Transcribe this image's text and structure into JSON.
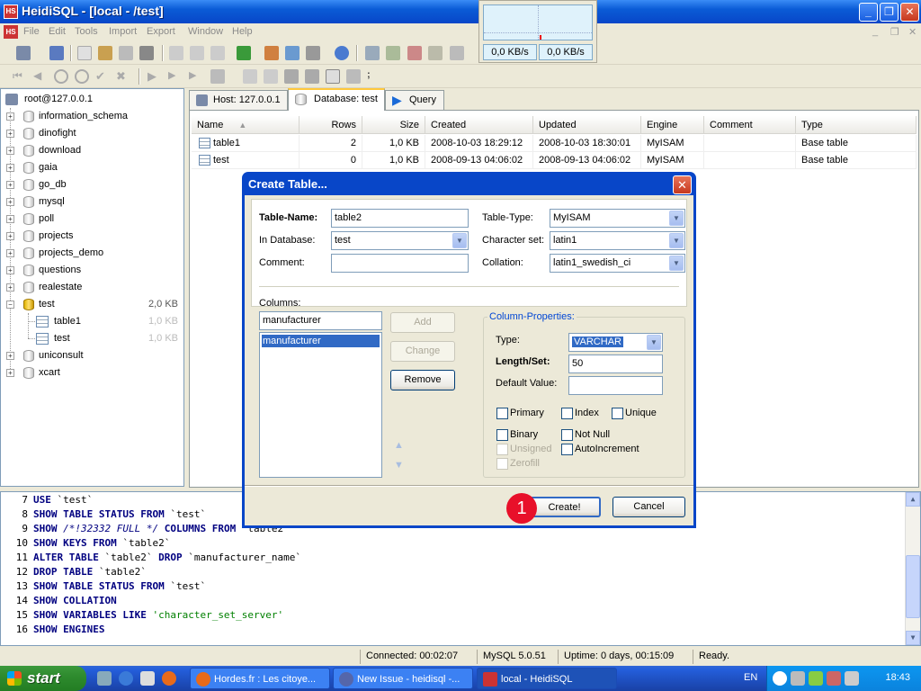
{
  "window": {
    "title": "HeidiSQL - [local - /test]",
    "app_icon": "HS"
  },
  "menu": [
    "File",
    "Edit",
    "Tools",
    "Import",
    "Export",
    "Window",
    "Help"
  ],
  "netmon": {
    "rate_in": "0,0 KB/s",
    "rate_out": "0,0 KB/s"
  },
  "tree": {
    "root": "root@127.0.0.1",
    "databases": [
      {
        "name": "information_schema"
      },
      {
        "name": "dinofight"
      },
      {
        "name": "download"
      },
      {
        "name": "gaia"
      },
      {
        "name": "go_db"
      },
      {
        "name": "mysql"
      },
      {
        "name": "poll"
      },
      {
        "name": "projects"
      },
      {
        "name": "projects_demo"
      },
      {
        "name": "questions"
      },
      {
        "name": "realestate"
      },
      {
        "name": "test",
        "size": "2,0 KB"
      },
      {
        "name": "table1",
        "size": "1,0 KB"
      },
      {
        "name": "test",
        "size": "1,0 KB"
      },
      {
        "name": "uniconsult"
      },
      {
        "name": "xcart"
      }
    ]
  },
  "tabs": [
    "Host: 127.0.0.1",
    "Database: test",
    "Query"
  ],
  "grid": {
    "headers": [
      "Name",
      "Rows",
      "Size",
      "Created",
      "Updated",
      "Engine",
      "Comment",
      "Type"
    ],
    "rows": [
      [
        "table1",
        "2",
        "1,0 KB",
        "2008-10-03 18:29:12",
        "2008-10-03 18:30:01",
        "MyISAM",
        "",
        "Base table"
      ],
      [
        "test",
        "0",
        "1,0 KB",
        "2008-09-13 04:06:02",
        "2008-09-13 04:06:02",
        "MyISAM",
        "",
        "Base table"
      ]
    ]
  },
  "dialog": {
    "title": "Create Table...",
    "table_name_label": "Table-Name:",
    "table_name": "table2",
    "in_database_label": "In Database:",
    "in_database": "test",
    "comment_label": "Comment:",
    "comment": "",
    "table_type_label": "Table-Type:",
    "table_type": "MyISAM",
    "charset_label": "Character set:",
    "charset": "latin1",
    "collation_label": "Collation:",
    "collation": "latin1_swedish_ci",
    "columns_label": "Columns:",
    "column_input": "manufacturer",
    "columns": [
      "manufacturer"
    ],
    "add_label": "Add",
    "change_label": "Change",
    "remove_label": "Remove",
    "props_legend": "Column-Properties:",
    "type_label": "Type:",
    "type_value": "VARCHAR",
    "length_label": "Length/Set:",
    "length_value": "50",
    "default_label": "Default Value:",
    "default_value": "",
    "chk_primary": "Primary",
    "chk_index": "Index",
    "chk_unique": "Unique",
    "chk_binary": "Binary",
    "chk_notnull": "Not Null",
    "chk_unsigned": "Unsigned",
    "chk_autoinc": "AutoIncrement",
    "chk_zerofill": "Zerofill",
    "create_label": "Create!",
    "cancel_label": "Cancel"
  },
  "badge": "1",
  "sql_log": [
    {
      "n": "7",
      "parts": [
        [
          "kw",
          "USE"
        ],
        [
          "",
          " `test`"
        ]
      ]
    },
    {
      "n": "8",
      "parts": [
        [
          "kw",
          "SHOW TABLE STATUS FROM"
        ],
        [
          "",
          " `test`"
        ]
      ]
    },
    {
      "n": "9",
      "parts": [
        [
          "kw",
          "SHOW"
        ],
        [
          "cmt",
          " /*!32332 FULL */"
        ],
        [
          "kw",
          " COLUMNS FROM"
        ],
        [
          "",
          " `table2`"
        ]
      ]
    },
    {
      "n": "10",
      "parts": [
        [
          "kw",
          "SHOW KEYS FROM"
        ],
        [
          "",
          " `table2`"
        ]
      ]
    },
    {
      "n": "11",
      "parts": [
        [
          "kw",
          "ALTER TABLE"
        ],
        [
          "",
          " `table2` "
        ],
        [
          "kw",
          "DROP"
        ],
        [
          "",
          " `manufacturer_name`"
        ]
      ]
    },
    {
      "n": "12",
      "parts": [
        [
          "kw",
          "DROP TABLE"
        ],
        [
          "",
          " `table2`"
        ]
      ]
    },
    {
      "n": "13",
      "parts": [
        [
          "kw",
          "SHOW TABLE STATUS FROM"
        ],
        [
          "",
          " `test`"
        ]
      ]
    },
    {
      "n": "14",
      "parts": [
        [
          "kw",
          "SHOW COLLATION"
        ]
      ]
    },
    {
      "n": "15",
      "parts": [
        [
          "kw",
          "SHOW VARIABLES LIKE"
        ],
        [
          "str",
          " 'character_set_server'"
        ]
      ]
    },
    {
      "n": "16",
      "parts": [
        [
          "kw",
          "SHOW ENGINES"
        ]
      ]
    }
  ],
  "status": {
    "connected": "Connected: 00:02:07",
    "version": "MySQL 5.0.51",
    "uptime": "Uptime: 0 days, 00:15:09",
    "state": "Ready."
  },
  "taskbar": {
    "start": "start",
    "tasks": [
      "Hordes.fr : Les citoye...",
      "New Issue - heidisql -...",
      "local - HeidiSQL"
    ],
    "lang": "EN",
    "clock": "18:43"
  }
}
